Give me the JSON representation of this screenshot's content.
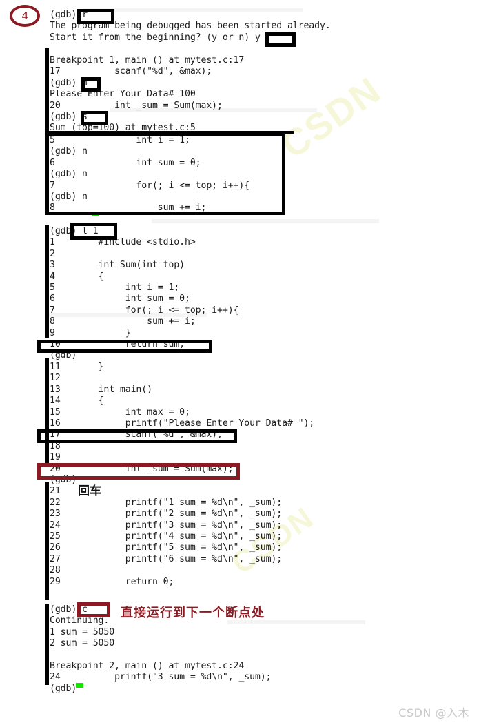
{
  "meta": {
    "step_number": "4",
    "watermark_faint": "CSDN",
    "watermark_bottom": "CSDN @入木"
  },
  "terminal": {
    "block1": "(gdb) r\nThe program being debugged has been started already.\nStart it from the beginning? (y or n) y",
    "block2": "Breakpoint 1, main () at mytest.c:17\n17          scanf(\"%d\", &max);\n(gdb) n\nPlease Enter Your Data# 100\n20          int _sum = Sum(max);\n(gdb) s\nSum (top=100) at mytest.c:5",
    "block3": "5               int i = 1;\n(gdb) n\n6               int sum = 0;\n(gdb) n\n7               for(; i <= top; i++){\n(gdb) n\n8                   sum += i;",
    "block4": "(gdb) l 1\n1        #include <stdio.h>\n2\n3        int Sum(int top)\n4        {\n5             int i = 1;\n6             int sum = 0;\n7             for(; i <= top; i++){\n8                 sum += i;\n9             }\n10            return sum;\n(gdb)\n11       }\n12\n13       int main()\n14       {\n15            int max = 0;\n16            printf(\"Please Enter Your Data# \");\n17            scanf(\"%d\", &max);\n18\n19\n20            int _sum = Sum(max);\n(gdb)\n21\n22            printf(\"1 sum = %d\\n\", _sum);\n23            printf(\"2 sum = %d\\n\", _sum);\n24            printf(\"3 sum = %d\\n\", _sum);\n25            printf(\"4 sum = %d\\n\", _sum);\n26            printf(\"5 sum = %d\\n\", _sum);\n27            printf(\"6 sum = %d\\n\", _sum);\n28\n29            return 0;",
    "block5": "(gdb) c\nContinuing.\n1 sum = 5050\n2 sum = 5050\n\nBreakpoint 2, main () at mytest.c:24\n24          printf(\"3 sum = %d\\n\", _sum);\n(gdb)"
  },
  "commands": {
    "run": "r",
    "confirm_yes": "y",
    "next_1": "n",
    "step": "s",
    "list": "l 1",
    "continue": "c"
  },
  "annotations": {
    "enter_key": "回车",
    "continue_note": "直接运行到下一个断点处"
  },
  "colors": {
    "highlight_black": "#000000",
    "highlight_red": "#8b1a22",
    "cursor_green": "#15e400",
    "terminal_text": "#1c1c1c"
  }
}
